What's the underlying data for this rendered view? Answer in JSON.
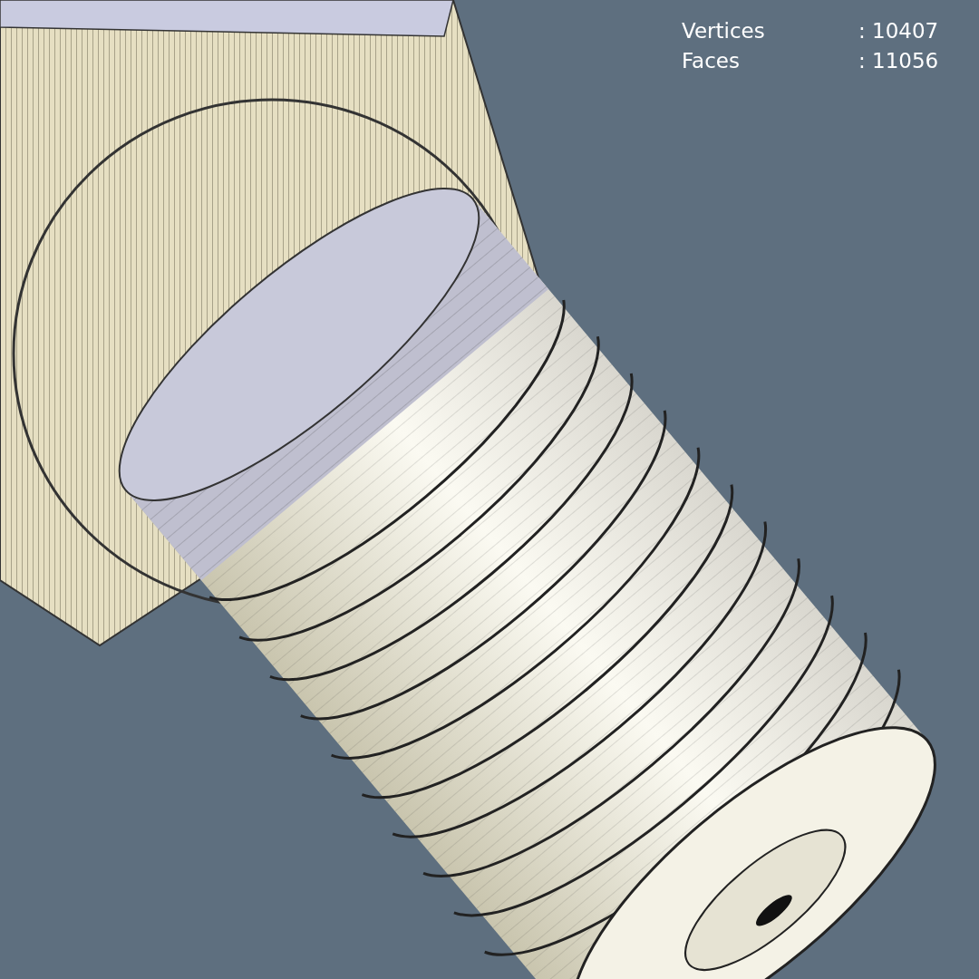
{
  "viewport": {
    "stats": [
      {
        "label": "Vertices",
        "value": ": 10407"
      },
      {
        "label": "Faces",
        "value": ": 11056"
      }
    ]
  }
}
